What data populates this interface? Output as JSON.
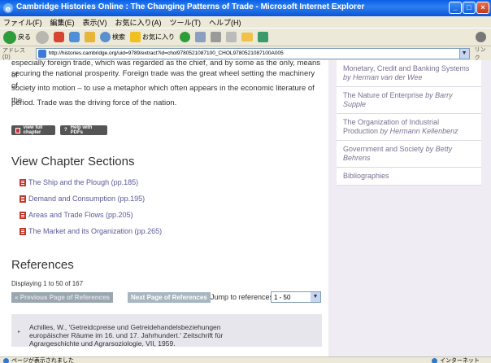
{
  "window": {
    "title": "Cambridge Histories Online : The Changing Patterns of Trade - Microsoft Internet Explorer",
    "minimize": "_",
    "maximize": "□",
    "close": "×"
  },
  "menu": [
    "ファイル(F)",
    "編集(E)",
    "表示(V)",
    "お気に入り(A)",
    "ツール(T)",
    "ヘルプ(H)"
  ],
  "toolbar": {
    "back_label": "戻る",
    "search_label": "検索",
    "favorites_label": "お気に入り"
  },
  "address": {
    "label": "アドレス(D)",
    "url": "http://histories.cambridge.org/uid=9789/extract?id=chol9780521087100_CHOL9780521087100A005",
    "go_label": "リンク"
  },
  "main": {
    "para_top": "especially foreign trade, which was regarded as the chief, and by some as the only, means of",
    "para_lines": [
      "securing the national prosperity. Foreign trade was the great wheel setting the machinery of",
      "society into motion – to use a metaphor which often appears in the economic literature of the",
      "period. Trade was the driving force of the nation."
    ],
    "view_full_chapter": "view full chapter",
    "help_with_pdfs": "Help with PDFs",
    "sections_heading": "View Chapter Sections",
    "chapters": [
      "The Ship and the Plough (pp.185)",
      "Demand and Consumption (pp.195)",
      "Areas and Trade Flows (pp.205)",
      "The Market and its Organization (pp.265)"
    ],
    "references_heading": "References",
    "displaying": "Displaying 1 to 50 of 167",
    "prev_refs": "« Previous Page of References",
    "next_refs": "Next Page of References",
    "jump_label": "Jump to references",
    "jump_value": "1 - 50",
    "reference_1": {
      "line1": "Achilles, W., 'Getreidcpreise und Getreidehandelsbeziehungen",
      "line2": "europäischer Räume im 16. und 17. Jahrhundert.' Zeitschrift für",
      "line3": "Agrargeschichte und Agrarsoziologie, VII, 1959."
    }
  },
  "sidebar": {
    "items": [
      {
        "title": "Monetary, Credit and Banking Systems",
        "by": "by",
        "author": "Herman van der Wee"
      },
      {
        "title": "The Nature of Enterprise",
        "by": "by",
        "author": "Barry Supple"
      },
      {
        "title": "The Organization of Industrial Production",
        "by": "by",
        "author": "Hermann Kellenbenz"
      },
      {
        "title": "Government and Society",
        "by": "by",
        "author": "Betty Behrens"
      },
      {
        "title": "Bibliographies",
        "by": "",
        "author": ""
      }
    ]
  },
  "status": {
    "left": "ページが表示されました",
    "right": "インターネット"
  },
  "colors": {
    "titlebar": "#0a5fe6",
    "link": "#5c5a9a",
    "sidebar_text": "#7a7090",
    "pdf": "#c0392b"
  }
}
